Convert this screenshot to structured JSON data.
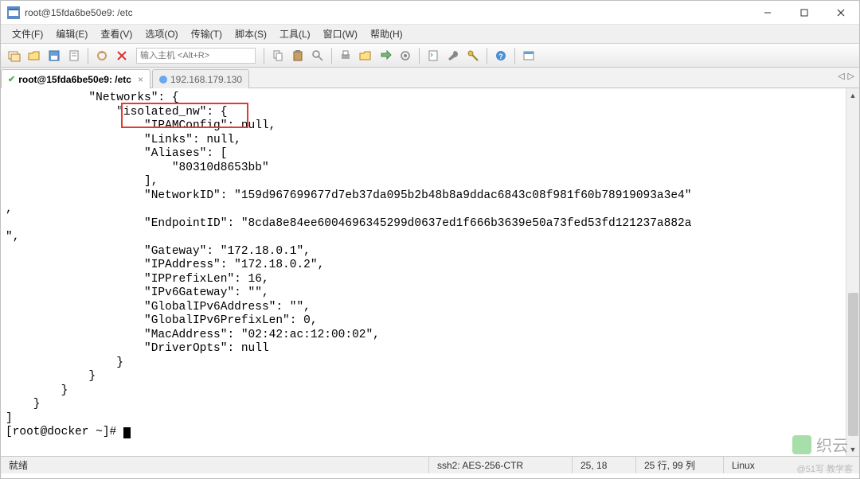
{
  "window": {
    "title": "root@15fda6be50e9: /etc"
  },
  "menu": {
    "file": "文件(F)",
    "edit": "编辑(E)",
    "view": "查看(V)",
    "options": "选项(O)",
    "transfer": "传输(T)",
    "script": "脚本(S)",
    "tools": "工具(L)",
    "window": "窗口(W)",
    "help": "帮助(H)"
  },
  "toolbar": {
    "host_placeholder": "输入主机 <Alt+R>"
  },
  "tabs": {
    "active": "root@15fda6be50e9: /etc",
    "inactive": "192.168.179.130"
  },
  "terminal": {
    "lines": [
      "            \"Networks\": {",
      "                \"isolated_nw\": {",
      "                    \"IPAMConfig\": null,",
      "                    \"Links\": null,",
      "                    \"Aliases\": [",
      "                        \"80310d8653bb\"",
      "                    ],",
      "                    \"NetworkID\": \"159d967699677d7eb37da095b2b48b8a9ddac6843c08f981f60b78919093a3e4\"",
      ",",
      "                    \"EndpointID\": \"8cda8e84ee6004696345299d0637ed1f666b3639e50a73fed53fd121237a882a",
      "\",",
      "                    \"Gateway\": \"172.18.0.1\",",
      "                    \"IPAddress\": \"172.18.0.2\",",
      "                    \"IPPrefixLen\": 16,",
      "                    \"IPv6Gateway\": \"\",",
      "                    \"GlobalIPv6Address\": \"\",",
      "                    \"GlobalIPv6PrefixLen\": 0,",
      "                    \"MacAddress\": \"02:42:ac:12:00:02\",",
      "                    \"DriverOpts\": null",
      "                }",
      "            }",
      "        }",
      "    }",
      "]",
      "[root@docker ~]# "
    ]
  },
  "status": {
    "ready": "就绪",
    "cipher": "ssh2: AES-256-CTR",
    "cursor": "25,  18",
    "size": "25 行, 99 列",
    "os": "Linux"
  },
  "watermark": {
    "text": "织云",
    "sub": "@51写 教学客"
  }
}
